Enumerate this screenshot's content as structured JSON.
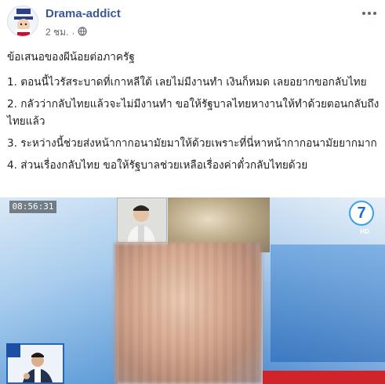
{
  "post": {
    "author": "Drama-addict",
    "time": "2 ชม.",
    "separator": "·",
    "privacy_icon": "globe-icon",
    "more_icon": "more-options-icon",
    "lines": [
      "ข้อเสนอของผีน้อยต่อภาครัฐ",
      "1. ตอนนี้ไวรัสระบาดที่เกาหลีใต้ เลยไม่มีงานทำ เงินก็หมด เลยอยากขอกลับไทย",
      "2. กลัวว่ากลับไทยแล้วจะไม่มีงานทำ ขอให้รัฐบาลไทยหางานให้ทำด้วยตอนกลับถึงไทยแล้ว",
      "3. ระหว่างนี้ช่วยส่งหน้ากากอนามัยมาให้ด้วยเพราะที่นี่หาหน้ากากอนามัยยากมาก",
      "4. ส่วนเรื่องกลับไทย ขอให้รัฐบาลช่วยเหลือเรื่องค่าตั๋วกลับไทยด้วย"
    ]
  },
  "media": {
    "timestamp": "08:56:31",
    "channel_number": "7",
    "channel_sub": "HD"
  },
  "colors": {
    "author_link": "#385898",
    "meta_gray": "#616770",
    "text": "#1c1e21",
    "red_bar": "#d0242a"
  }
}
